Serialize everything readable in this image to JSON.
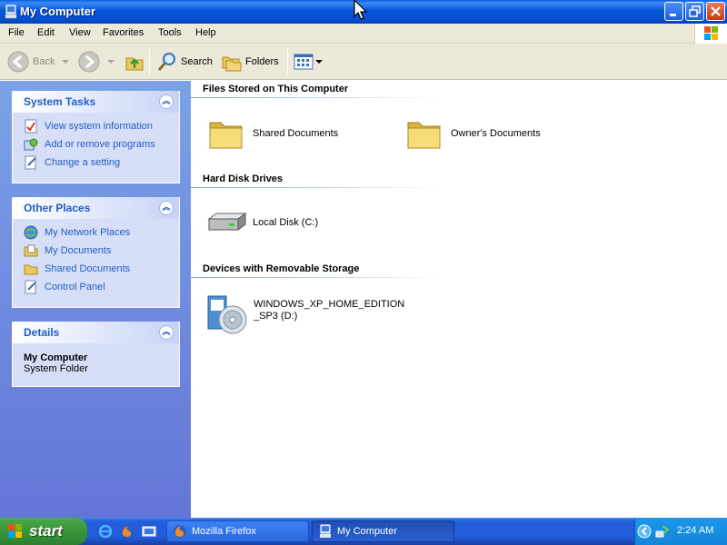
{
  "window": {
    "title": "My Computer"
  },
  "menu": {
    "items": [
      "File",
      "Edit",
      "View",
      "Favorites",
      "Tools",
      "Help"
    ]
  },
  "toolbar": {
    "back_label": "Back",
    "search_label": "Search",
    "folders_label": "Folders"
  },
  "taskpane": {
    "system_tasks": {
      "title": "System Tasks",
      "links": [
        "View system information",
        "Add or remove programs",
        "Change a setting"
      ]
    },
    "other_places": {
      "title": "Other Places",
      "links": [
        "My Network Places",
        "My Documents",
        "Shared Documents",
        "Control Panel"
      ]
    },
    "details": {
      "title": "Details",
      "name": "My Computer",
      "type": "System Folder"
    }
  },
  "content": {
    "groups": [
      {
        "title": "Files Stored on This Computer",
        "items": [
          "Shared Documents",
          "Owner's Documents"
        ]
      },
      {
        "title": "Hard Disk Drives",
        "items": [
          "Local Disk (C:)"
        ]
      },
      {
        "title": "Devices with Removable Storage",
        "items": [
          "WINDOWS_XP_HOME_EDITION",
          "_SP3 (D:)"
        ]
      }
    ]
  },
  "taskbar": {
    "start_label": "start",
    "tasks": [
      "Mozilla Firefox",
      "My Computer"
    ],
    "clock": "2:24 AM"
  },
  "colors": {
    "titlebar_blue": "#0756d8",
    "link_blue": "#215dc6",
    "taskpane_bg": "#6f8ddf",
    "menu_bg": "#ece9d8"
  }
}
